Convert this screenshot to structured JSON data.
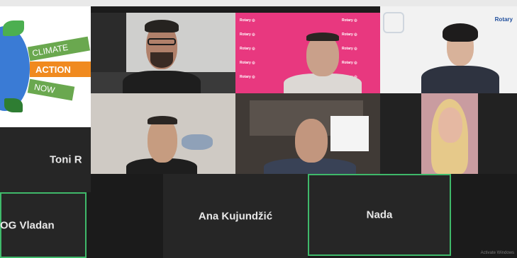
{
  "meeting": {
    "participants": [
      {
        "name": "Toni R"
      },
      {
        "name": "Ana Kujundžić"
      },
      {
        "name": "Nada"
      },
      {
        "name": "OG Vladan"
      }
    ],
    "climate_logo": {
      "line1": "CLIMATE",
      "line2": "ACTION",
      "line3": "NOW"
    },
    "rotary_logo": "Rotary",
    "status_text": "Activate Windows"
  },
  "colors": {
    "active_speaker_border": "#3fb96a",
    "pink_background": "#e8387f",
    "climate_green": "#6aa84f",
    "climate_orange": "#f08a1f"
  }
}
